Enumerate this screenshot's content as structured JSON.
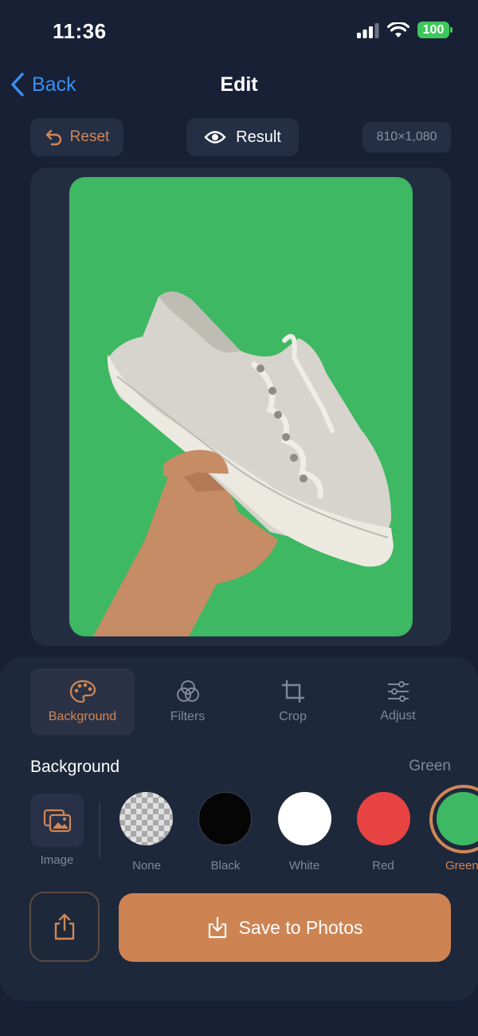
{
  "status_bar": {
    "time": "11:36",
    "battery": "100"
  },
  "nav": {
    "back_label": "Back",
    "title": "Edit"
  },
  "toolbar": {
    "reset_label": "Reset",
    "result_label": "Result",
    "dimensions": "810×1,080"
  },
  "tools": [
    {
      "label": "Background",
      "icon": "palette-icon",
      "active": true
    },
    {
      "label": "Filters",
      "icon": "filters-icon",
      "active": false
    },
    {
      "label": "Crop",
      "icon": "crop-icon",
      "active": false
    },
    {
      "label": "Adjust",
      "icon": "sliders-icon",
      "active": false
    }
  ],
  "background_section": {
    "title": "Background",
    "selected": "Green",
    "image_label": "Image"
  },
  "swatches": [
    {
      "label": "None",
      "color": "transparent"
    },
    {
      "label": "Black",
      "color": "#050505"
    },
    {
      "label": "White",
      "color": "#ffffff"
    },
    {
      "label": "Red",
      "color": "#e84343"
    },
    {
      "label": "Green",
      "color": "#3eb862"
    }
  ],
  "actions": {
    "save_label": "Save to Photos"
  },
  "colors": {
    "accent": "#cd8452",
    "link": "#3a8ff2",
    "canvas_bg": "#3eb862"
  }
}
